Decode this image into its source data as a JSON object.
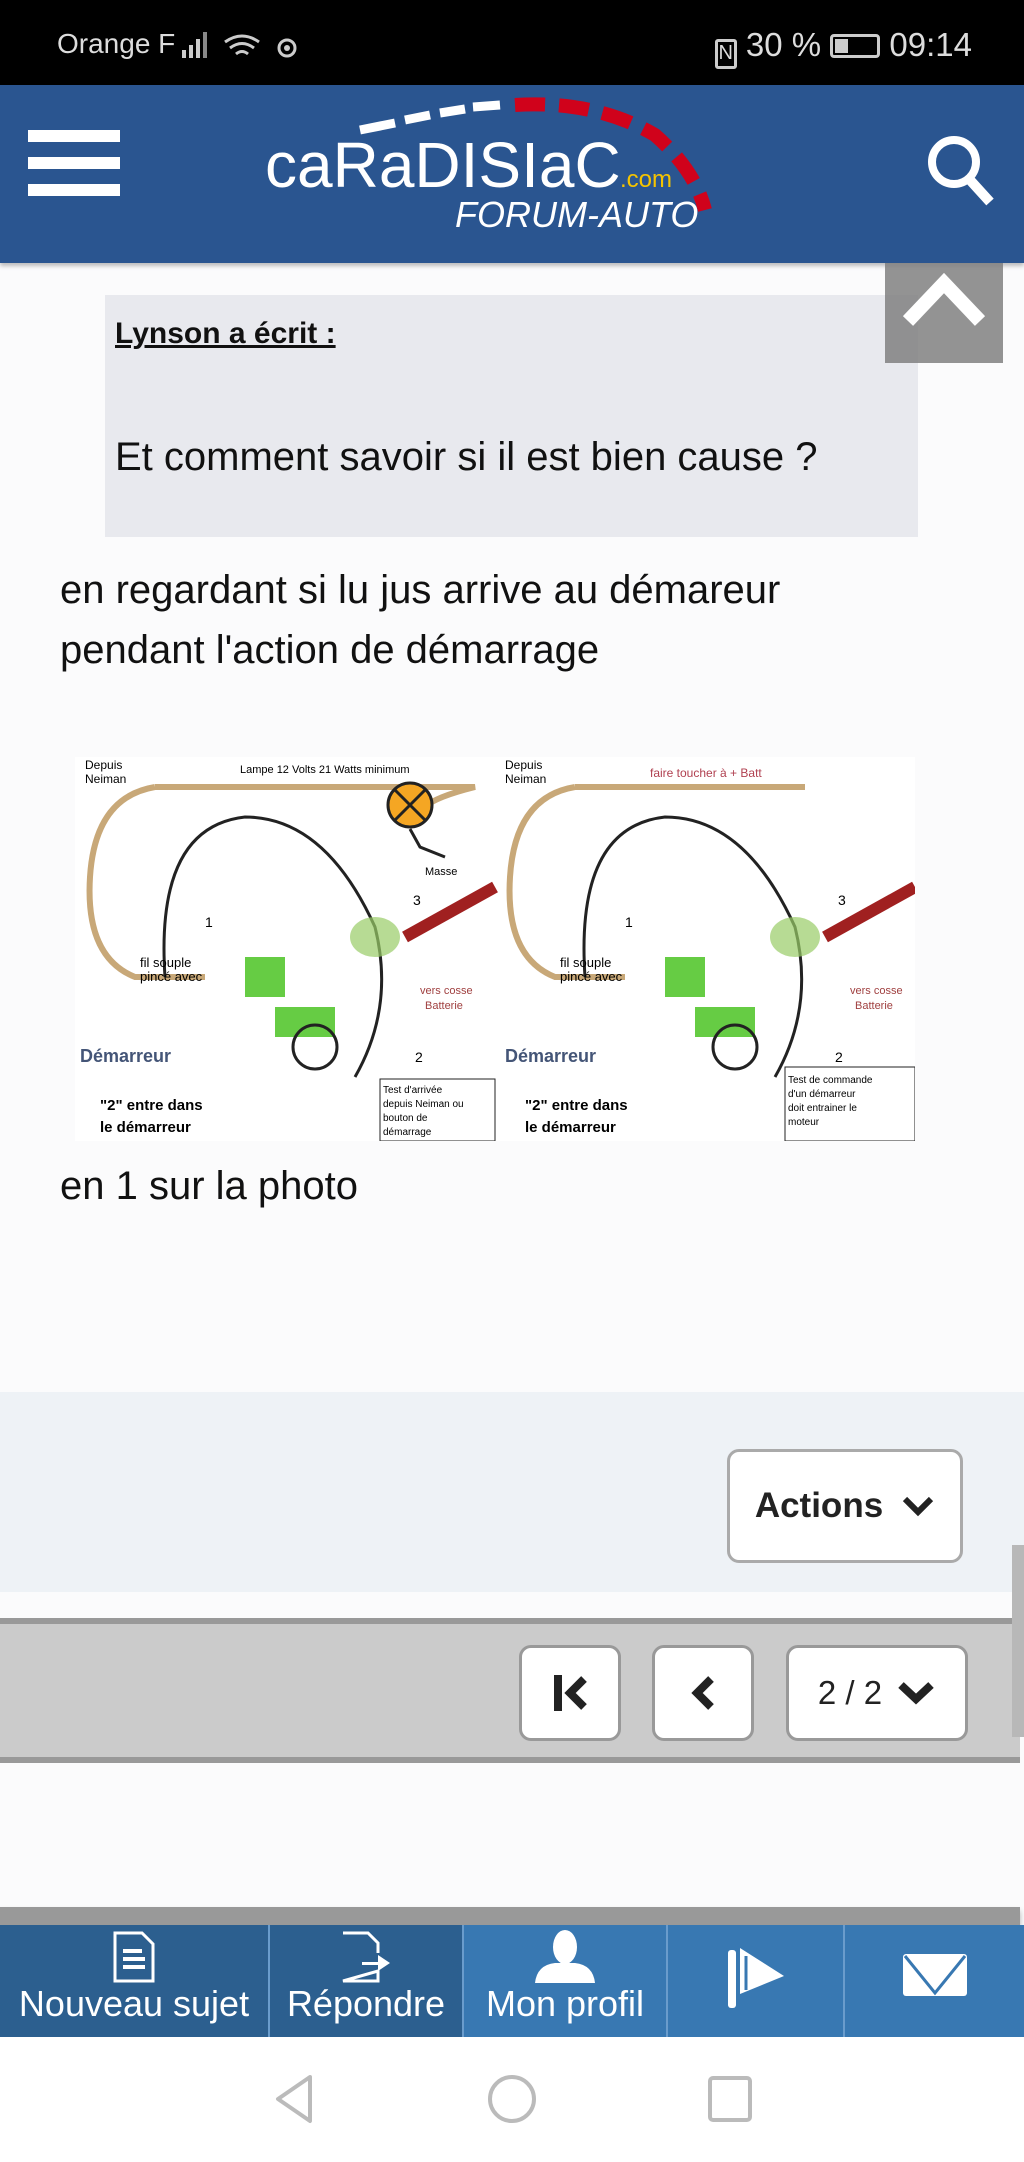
{
  "status_bar": {
    "carrier": "Orange F",
    "battery": "30 %",
    "time": "09:14",
    "icons": [
      "signal-icon",
      "wifi-icon",
      "eye-icon",
      "nfc-icon",
      "battery-icon"
    ]
  },
  "header": {
    "logo_main": "caRaDISIaC",
    "logo_tld": ".com",
    "logo_sub": "FORUM-AUTO",
    "colors": {
      "bar": "#2a5590",
      "accent": "#d0021b",
      "tld": "#f5c400"
    }
  },
  "post": {
    "quote": {
      "author": "Lynson a écrit :",
      "text": "Et comment savoir si il est bien cause ?"
    },
    "lines": [
      "en regardant si lu jus arrive au démareur",
      "pendant l'action de démarrage"
    ],
    "diagram": {
      "left": {
        "depuis": "Depuis",
        "neiman": "Neiman",
        "lamp": "Lampe 12 Volts 21 Watts minimum",
        "masse": "Masse",
        "n1": "1",
        "n2": "2",
        "n3": "3",
        "fil1": "fil souple",
        "fil2": "pincé avec",
        "vers1": "vers cosse",
        "vers2": "Batterie",
        "demarreur": "Démarreur",
        "entre1": "\"2\" entre dans",
        "entre2": "le démarreur",
        "test": [
          "Test d'arrivée",
          "depuis Neiman ou",
          "bouton de",
          "démarrage"
        ]
      },
      "right": {
        "depuis": "Depuis",
        "neiman": "Neiman",
        "toucher": "faire toucher  à + Batt",
        "n1": "1",
        "n2": "2",
        "n3": "3",
        "fil1": "fil souple",
        "fil2": "pincé avec",
        "vers1": "vers cosse",
        "vers2": "Batterie",
        "demarreur": "Démarreur",
        "entre1": "\"2\" entre dans",
        "entre2": "le démarreur",
        "test": [
          "Test de commande",
          "d'un démarreur",
          "doit entrainer le",
          "moteur"
        ]
      }
    },
    "after": "en 1 sur la photo"
  },
  "actions": {
    "label": "Actions"
  },
  "pagination": {
    "page": "2 / 2"
  },
  "bottom_nav": [
    {
      "label": "Nouveau sujet",
      "icon": "new-document-icon"
    },
    {
      "label": "Répondre",
      "icon": "reply-document-icon"
    },
    {
      "label": "Mon profil",
      "icon": "user-icon"
    },
    {
      "label": "",
      "icon": "flag-icon"
    },
    {
      "label": "",
      "icon": "envelope-icon"
    }
  ]
}
